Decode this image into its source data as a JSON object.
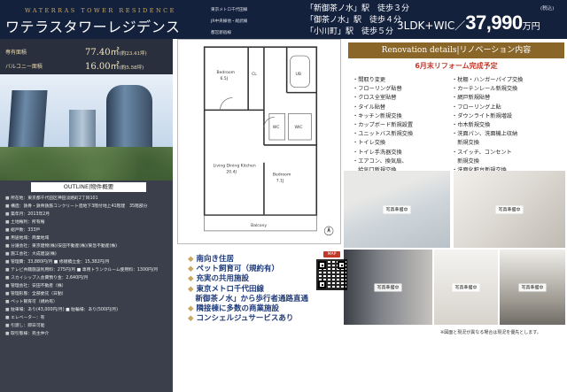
{
  "header": {
    "name_en": "WATERRAS TOWER RESIDENCE",
    "name_jp": "ワテラスタワーレジデンス",
    "lines": [
      "東京メトロ千代田線",
      "JR中央線他・総武線",
      "都営新宿線"
    ],
    "stations": [
      {
        "name": "「新御茶ノ水」駅",
        "walk": "徒歩３分"
      },
      {
        "name": "「御茶ノ水」駅",
        "walk": "徒歩４分"
      },
      {
        "name": "「小川町」駅",
        "walk": "徒歩５分"
      }
    ],
    "layout": "3LDK+WIC／",
    "price": "37,990",
    "price_unit": "万円",
    "tax": "(税込)"
  },
  "area": {
    "exclusive_label": "専有面積",
    "exclusive_value": "77.40㎡",
    "exclusive_sub": "(約23.41坪)",
    "balcony_label": "バルコニー面積",
    "balcony_value": "16.00㎡",
    "balcony_sub": "(約5.58坪)"
  },
  "outline": {
    "title": "OUTLINE|物件概要",
    "items": [
      "所在地：東京都千代田区神田淡路町2丁目101",
      "構造：鉄骨・鉄骨鉄筋コンクリート造地下3階付地上41階建　35階部分",
      "築年月：2013年2月",
      "土地権利：所有権",
      "総戸数：333戸",
      "用途地域：商業地域",
      "分譲会社：東京建物(株)/安田不動産(株)/東急不動産(株)",
      "施工会社：大成建設(株)",
      "管理費：33,880円/月 ■ 修繕積立金：15,382円/月",
      "テレビ共聴施設利用料：275円/月 ■ 専用トランクルーム使用料：1300円/月",
      "スカイシップ入会費預り金：2,640円/月",
      "管理会社：安田不動産（株）",
      "管理形態：全部委託（日勤）",
      "ペット飼育可（規約有）",
      "駐車場：あり(43,000円/月) ■ 駐輪場：あり(500円/月)",
      "エレベーター：有",
      "引渡し：即日可能",
      "取引態様：売主仲介"
    ]
  },
  "plan": {
    "bedroom1": "Bedroom",
    "bedroom1_size": "6.5J",
    "bedroom2": "Bedroom",
    "bedroom2_size": "7.1J",
    "ldk": "Living Dining Kitchen",
    "ldk_size": "20.4J",
    "balcony": "Balcony",
    "wic": "WIC",
    "ub": "UB",
    "wc": "WC",
    "cl": "CL"
  },
  "renovation": {
    "title": "Renovation details|リノベーション内容",
    "subtitle": "6月末リフォーム完成予定",
    "left": [
      "間取り変更",
      "フローリング貼替",
      "クロス全室貼替",
      "タイル貼替",
      "キッチン新規交換",
      "カップボード新規設置",
      "ユニットバス新規交換",
      "トイレ交換",
      "トイレ手洗器交換",
      "エアコン、換気扇、",
      "給気口新規交換"
    ],
    "right": [
      "枕棚・ハンガーパイプ交換",
      "カーテンレール新規交換",
      "網戸新規貼替",
      "フローリング上貼",
      "ダウンライト新規増設",
      "巾木新規交換",
      "洗面パン、洗面機上収納",
      "新規交換",
      "スイッチ、コンセント",
      "新規交換",
      "洗面化粧台新規交換"
    ]
  },
  "photos": {
    "caption": "写真準備中",
    "note": "※図面と現況が異なる場合は現況を優先とします。"
  },
  "features": [
    "南向き住居",
    "ペット飼育可（規約有）",
    "充実の共用施設",
    "東京メトロ千代田線",
    "新御茶ノ水」から歩行者通路直通",
    "隣接棟に多数の商業施設",
    "コンシェルジュサービスあり"
  ],
  "qr": {
    "label": "MAP"
  }
}
